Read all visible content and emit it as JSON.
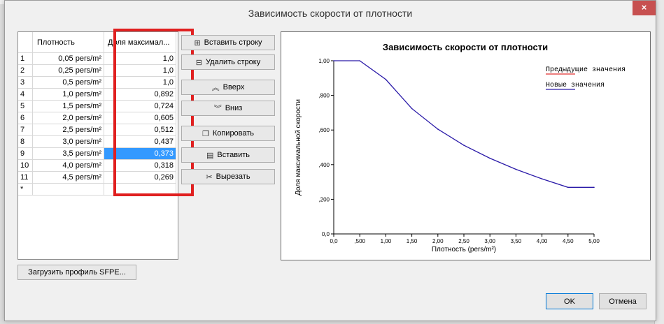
{
  "window": {
    "title": "Зависимость скорости от плотности",
    "close_label": "×"
  },
  "grid": {
    "columns": [
      "Плотность",
      "Доля максимал..."
    ],
    "rows": [
      {
        "idx": "1",
        "density": "0,05 pers/m²",
        "fraction": "1,0"
      },
      {
        "idx": "2",
        "density": "0,25 pers/m²",
        "fraction": "1,0"
      },
      {
        "idx": "3",
        "density": "0,5 pers/m²",
        "fraction": "1,0"
      },
      {
        "idx": "4",
        "density": "1,0 pers/m²",
        "fraction": "0,892"
      },
      {
        "idx": "5",
        "density": "1,5 pers/m²",
        "fraction": "0,724"
      },
      {
        "idx": "6",
        "density": "2,0 pers/m²",
        "fraction": "0,605"
      },
      {
        "idx": "7",
        "density": "2,5 pers/m²",
        "fraction": "0,512"
      },
      {
        "idx": "8",
        "density": "3,0 pers/m²",
        "fraction": "0,437"
      },
      {
        "idx": "9",
        "density": "3,5 pers/m²",
        "fraction": "0,373"
      },
      {
        "idx": "10",
        "density": "4,0 pers/m²",
        "fraction": "0,318"
      },
      {
        "idx": "11",
        "density": "4,5 pers/m²",
        "fraction": "0,269"
      }
    ],
    "new_row_marker": "*",
    "selected_row": 9
  },
  "buttons": {
    "insert_row": "Вставить строку",
    "delete_row": "Удалить строку",
    "up": "Вверх",
    "down": "Вниз",
    "copy": "Копировать",
    "paste": "Вставить",
    "cut": "Вырезать",
    "load_sfpe": "Загрузить профиль SFPE...",
    "ok": "OK",
    "cancel": "Отмена"
  },
  "icons": {
    "insert_row": "insert-row-icon",
    "delete_row": "delete-row-icon",
    "up": "chevron-up-icon",
    "down": "chevron-down-icon",
    "copy": "copy-icon",
    "paste": "paste-icon",
    "cut": "scissors-icon"
  },
  "chart_data": {
    "type": "line",
    "title": "Зависимость скорости от плотности",
    "xlabel": "Плотность (pers/m²)",
    "ylabel": "Доля максимальной скорости",
    "xlim": [
      0,
      5
    ],
    "ylim": [
      0,
      1
    ],
    "x_ticks": [
      "0,0",
      ",500",
      "1,00",
      "1,50",
      "2,00",
      "2,50",
      "3,00",
      "3,50",
      "4,00",
      "4,50",
      "5,00"
    ],
    "y_ticks": [
      "0,0",
      ",200",
      ",400",
      ",600",
      ",800",
      "1,00"
    ],
    "legend_position": "top-right",
    "series": [
      {
        "name": "Предыдущие значения",
        "color": "#e03030",
        "x": [],
        "y": []
      },
      {
        "name": "Новые значения",
        "color": "#2a1aa8",
        "x": [
          0.0,
          0.5,
          1.0,
          1.5,
          2.0,
          2.5,
          3.0,
          3.5,
          4.0,
          4.5,
          5.0
        ],
        "y": [
          1.0,
          1.0,
          0.892,
          0.724,
          0.605,
          0.512,
          0.437,
          0.373,
          0.318,
          0.269,
          0.269
        ]
      }
    ]
  },
  "colors": {
    "selection": "#3399ff",
    "highlight_frame": "#e02020",
    "close_button": "#c75050"
  }
}
